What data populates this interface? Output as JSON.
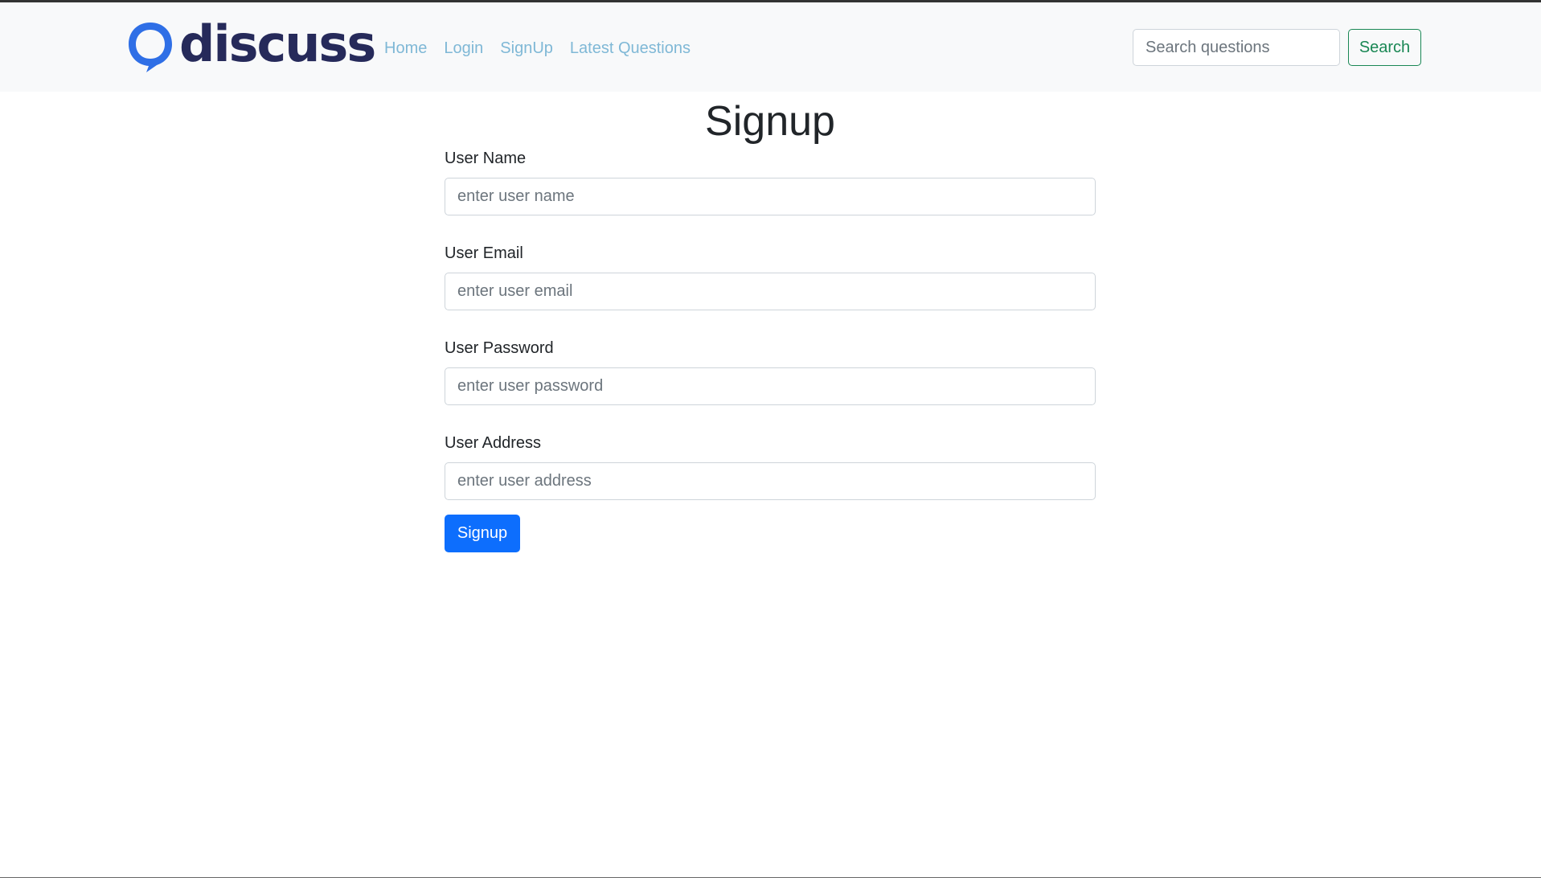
{
  "brand": {
    "name": "discuss",
    "logo_icon": "speech-bubble-icon",
    "logo_color": "#2f6fe6",
    "text_color": "#262a5a"
  },
  "nav": {
    "links": [
      {
        "label": "Home"
      },
      {
        "label": "Login"
      },
      {
        "label": "SignUp"
      },
      {
        "label": "Latest Questions"
      }
    ],
    "link_color": "#7fb8d6"
  },
  "search": {
    "placeholder": "Search questions",
    "button_label": "Search",
    "button_color": "#198754"
  },
  "signup": {
    "title": "Signup",
    "fields": [
      {
        "label": "User Name",
        "placeholder": "enter user name"
      },
      {
        "label": "User Email",
        "placeholder": "enter user email"
      },
      {
        "label": "User Password",
        "placeholder": "enter user password"
      },
      {
        "label": "User Address",
        "placeholder": "enter user address"
      }
    ],
    "submit_label": "Signup",
    "submit_color": "#0d6efd"
  }
}
